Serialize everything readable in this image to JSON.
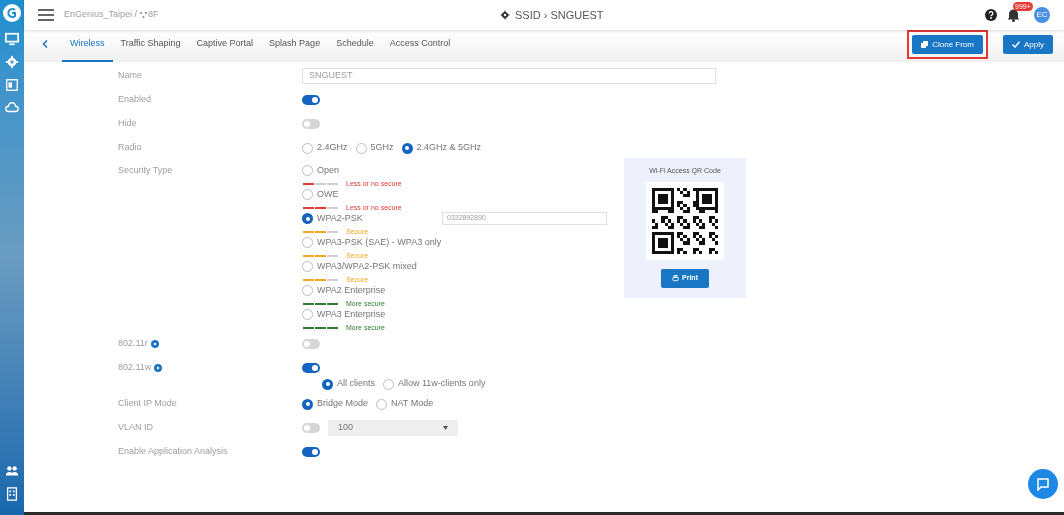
{
  "header": {
    "site": "EnGenius_Taipei /",
    "floor": "8F",
    "title": "SSID › SNGUEST",
    "notification_badge": "999+",
    "avatar": "EC"
  },
  "tabs": [
    {
      "label": "Wireless",
      "selected": true
    },
    {
      "label": "Traffic Shaping",
      "selected": false
    },
    {
      "label": "Captive Portal",
      "selected": false
    },
    {
      "label": "Splash Page",
      "selected": false
    },
    {
      "label": "Schedule",
      "selected": false
    },
    {
      "label": "Access Control",
      "selected": false
    }
  ],
  "actions": [
    {
      "label": "Clone From",
      "kind": "clone",
      "highlighted": true
    },
    {
      "label": "Apply",
      "kind": "apply",
      "highlighted": false
    }
  ],
  "form": [
    {
      "kind": "text",
      "label": "Name",
      "value": "SNGUEST"
    },
    {
      "kind": "toggle",
      "label": "Enabled",
      "on": true
    },
    {
      "kind": "toggle",
      "label": "Hide",
      "on": false
    },
    {
      "kind": "radio",
      "label": "Radio",
      "options": [
        {
          "label": "2.4GHz",
          "selected": false
        },
        {
          "label": "5GHz",
          "selected": false
        },
        {
          "label": "2.4GHz & 5GHz",
          "selected": true
        }
      ]
    },
    {
      "kind": "security",
      "label": "Security Type",
      "password": "0332892890",
      "qr_title": "Wi-Fi Access QR Code",
      "print": "Print",
      "options": [
        {
          "label": "Open",
          "selected": false,
          "level": 0.33,
          "strength": "Less or no secure",
          "color": "#e53935"
        },
        {
          "label": "OWE",
          "selected": false,
          "level": 0.67,
          "strength": "Less or no secure",
          "color": "#e53935"
        },
        {
          "label": "WPA2-PSK",
          "selected": true,
          "level": 0.67,
          "strength": "Secure",
          "color": "#f5a623"
        },
        {
          "label": "WPA3-PSK (SAE) - WPA3 only",
          "selected": false,
          "level": 0.67,
          "strength": "Secure",
          "color": "#f5a623"
        },
        {
          "label": "WPA3/WPA2-PSK mixed",
          "selected": false,
          "level": 0.67,
          "strength": "Secure",
          "color": "#f5a623"
        },
        {
          "label": "WPA2 Enterprise",
          "selected": false,
          "level": 1,
          "strength": "More secure",
          "color": "#2e7d32"
        },
        {
          "label": "WPA3 Enterprise",
          "selected": false,
          "level": 1,
          "strength": "More secure",
          "color": "#2e7d32"
        }
      ]
    },
    {
      "kind": "toggle",
      "label": "802.11r",
      "help": true,
      "on": false
    },
    {
      "kind": "toggle",
      "label": "802.11w",
      "help": true,
      "on": true,
      "options": [
        {
          "label": "All clients",
          "selected": true
        },
        {
          "label": "Allow 11w-clients only",
          "selected": false
        }
      ]
    },
    {
      "kind": "radio",
      "label": "Client IP Mode",
      "options": [
        {
          "label": "Bridge Mode",
          "selected": true
        },
        {
          "label": "NAT Mode",
          "selected": false
        }
      ]
    },
    {
      "kind": "toggle",
      "label": "VLAN ID",
      "on": false,
      "select": "100"
    },
    {
      "kind": "toggle",
      "label": "Enable Application Analysis",
      "on": true
    }
  ]
}
